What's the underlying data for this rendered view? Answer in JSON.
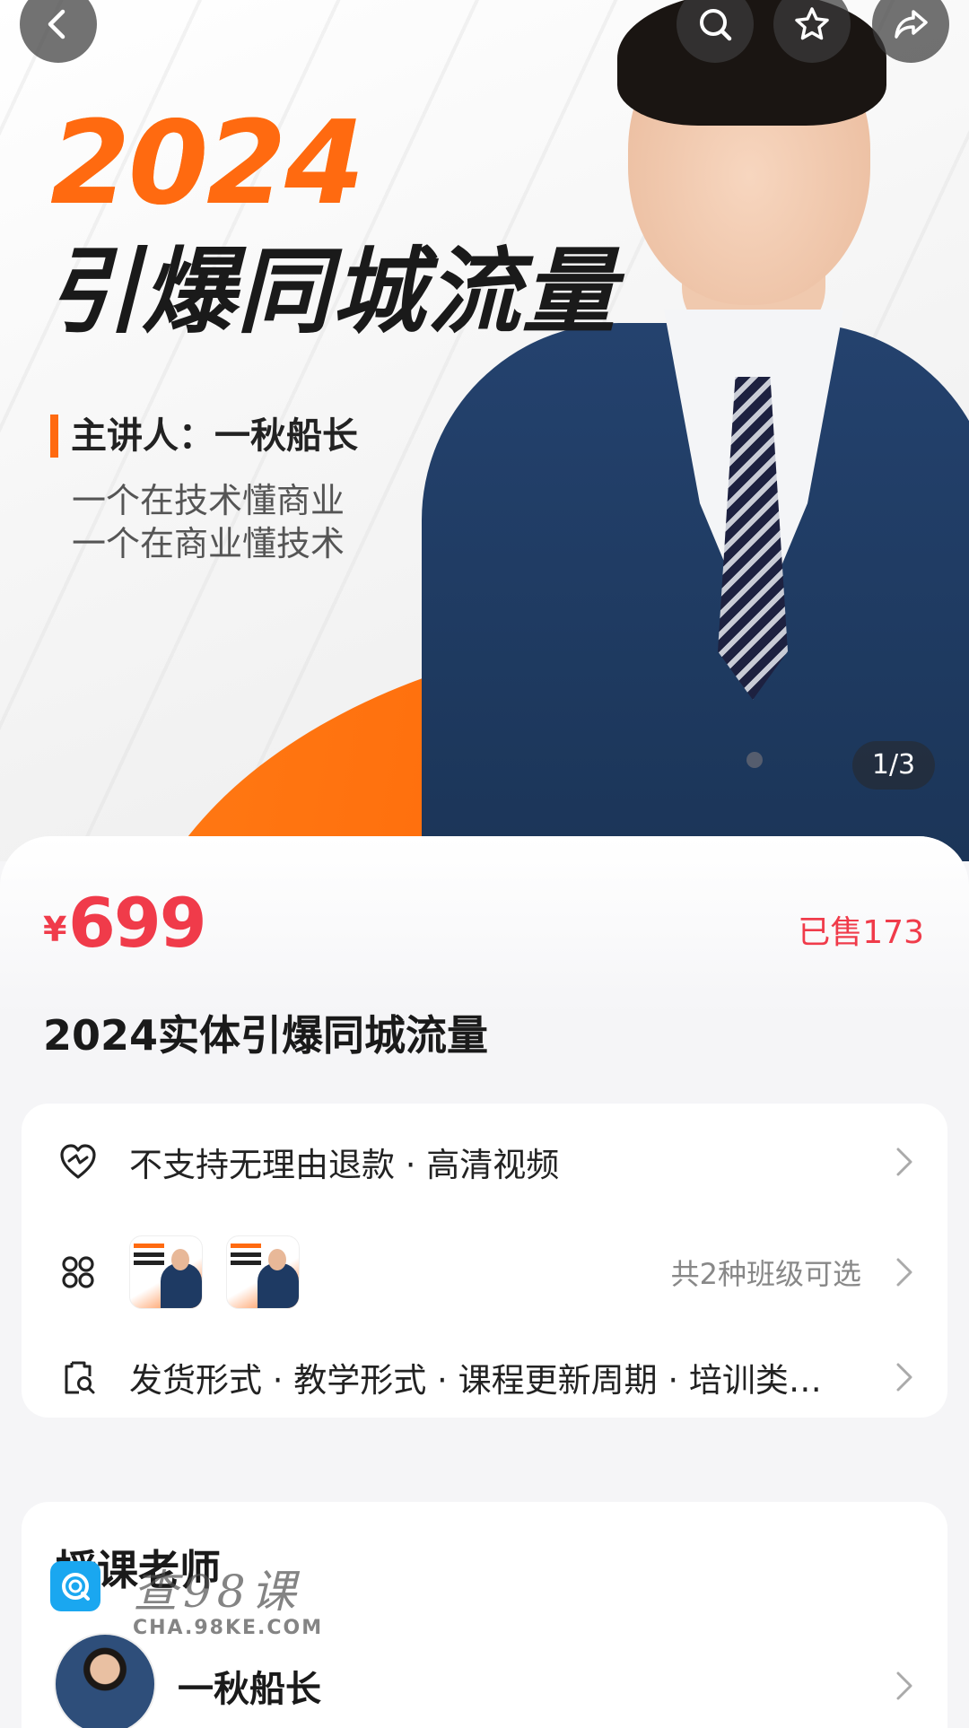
{
  "hero": {
    "year": "2024",
    "title": "引爆同城流量",
    "speaker": "主讲人：一秋船长",
    "tagline_1": "一个在技术懂商业",
    "tagline_2": "一个在商业懂技术",
    "pager": "1/3"
  },
  "top_icons": [
    "back-icon",
    "search-icon",
    "star-icon",
    "share-icon"
  ],
  "product": {
    "currency": "¥",
    "price": "699",
    "sold": "已售173",
    "title": "2024实体引爆同城流量"
  },
  "info": {
    "service_text": "不支持无理由退款 · 高清视频",
    "class_hint": "共2种班级可选",
    "detail_text": "发货形式 · 教学形式 · 课程更新周期 · 培训类…"
  },
  "teacher": {
    "heading": "授课老师",
    "name": "一秋船长"
  },
  "watermark": {
    "text": "查98课",
    "url": "CHA.98KE.COM"
  },
  "colors": {
    "accent": "#f03b4a",
    "brand_orange": "#ff6a10",
    "suit": "#24426e"
  }
}
